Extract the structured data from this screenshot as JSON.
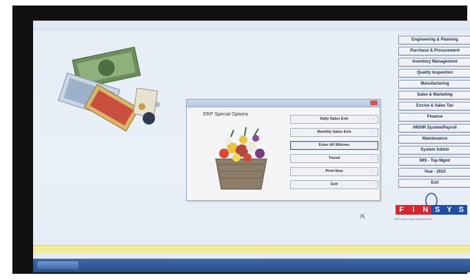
{
  "window": {
    "title": "",
    "controls": ""
  },
  "menu": {
    "items": [
      "Engineering & Planning",
      "Purchase & Procurement",
      "Inventory Management",
      "Quality Inspection",
      "Manufacturing",
      "Sales & Marketing",
      "Excise & Sales Tax",
      "Finance",
      "HR/HR System/Payroll",
      "Maintenance",
      "System Admin",
      "MIS - Top Mgmt",
      "Year - 2010",
      "Exit"
    ]
  },
  "dialog": {
    "heading": "ERP Special Options",
    "options": [
      "Daily Sales Entr",
      "Monthly Sales Entr",
      "Enter All Widows",
      "Tiered",
      "Print New",
      "Exit"
    ],
    "selected_index": 2,
    "footer": ""
  },
  "logo": {
    "letters": [
      "F",
      "I",
      "N",
      "S",
      "Y",
      "S"
    ],
    "tagline": "ERP SOLUTION PROVIDERS",
    "colors": {
      "red": "#d9262c",
      "blue": "#1f4fa3"
    }
  },
  "bottom": {
    "link1": "",
    "link2": "",
    "link3": "",
    "link4": "",
    "status": ""
  },
  "taskbar": {
    "tray": ""
  }
}
